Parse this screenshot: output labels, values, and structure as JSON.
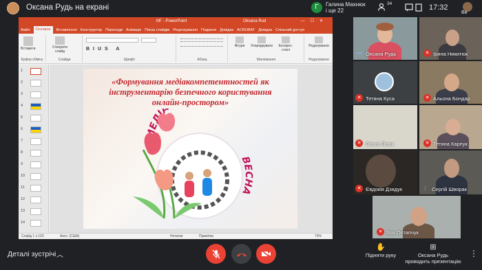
{
  "meet": {
    "presenting_title": "Оксана Рудь на екрані",
    "notification": {
      "initial": "Г",
      "name": "Галина Махнюк",
      "more": "і ще 22"
    },
    "participants_count": "34",
    "time": "17:32",
    "self_label": "Ви",
    "bottom": {
      "details_label": "Деталі зустрічі",
      "raise_hand_label": "Підняти руку",
      "presenting_label_line1": "Оксана Рудь",
      "presenting_label_line2": "проводить презентацію"
    },
    "participants": [
      {
        "name": "Оксана Рудь",
        "muted": false
      },
      {
        "name": "Ірина Никитюк",
        "muted": true
      },
      {
        "name": "Тетяна Куса",
        "muted": true
      },
      {
        "name": "Альона Бондар",
        "muted": true
      },
      {
        "name": "Ольга Ясюк",
        "muted": true
      },
      {
        "name": "Тетяна Карпук",
        "muted": true
      },
      {
        "name": "Євдокія Дзядук",
        "muted": true
      },
      {
        "name": "Сергій Шворак",
        "muted": false
      },
      {
        "name": "Зоя Остапчук",
        "muted": true
      }
    ]
  },
  "powerpoint": {
    "window_title": "МГ - PowerPoint",
    "user": "Oksana Rud",
    "tabs": [
      "Файл",
      "Основне",
      "Вставлення",
      "Конструктор",
      "Переходи",
      "Анімація",
      "Показ слайдів",
      "Рецензування",
      "Подання",
      "Довідка",
      "ACROBAT",
      "Довідка",
      "Спільний доступ"
    ],
    "groups": [
      "Буфер обміну",
      "Слайди",
      "Шрифт",
      "Абзац",
      "Малювання",
      "Редагування"
    ],
    "buttons": {
      "paste": "Вставити",
      "new_slide": "Створити слайд",
      "shapes": "Фігури",
      "arrange": "Упорядкувати",
      "styles": "Експрес-стилі",
      "editing": "Редагування"
    },
    "status": {
      "slide": "Слайд 1 з 120",
      "lang": "Англ. (США)",
      "notes": "Нотатки",
      "comments": "Примітки",
      "zoom": "73%"
    },
    "thumbnail_numbers": [
      "1",
      "2",
      "3",
      "4",
      "5",
      "6",
      "7",
      "8",
      "9",
      "10",
      "11",
      "12",
      "13",
      "14"
    ],
    "slide_title": "«Формування медіакомпетентностей як інструментарію безпечного користування онлайн-простором»",
    "logo_text_line1": "МЕДІАГРАМОТНА",
    "logo_text_line2": "ВЕСНА"
  },
  "colors": {
    "ppt_accent": "#d24726",
    "meet_bg": "#202124",
    "end_call": "#ea4335",
    "slide_title": "#c0272d"
  }
}
